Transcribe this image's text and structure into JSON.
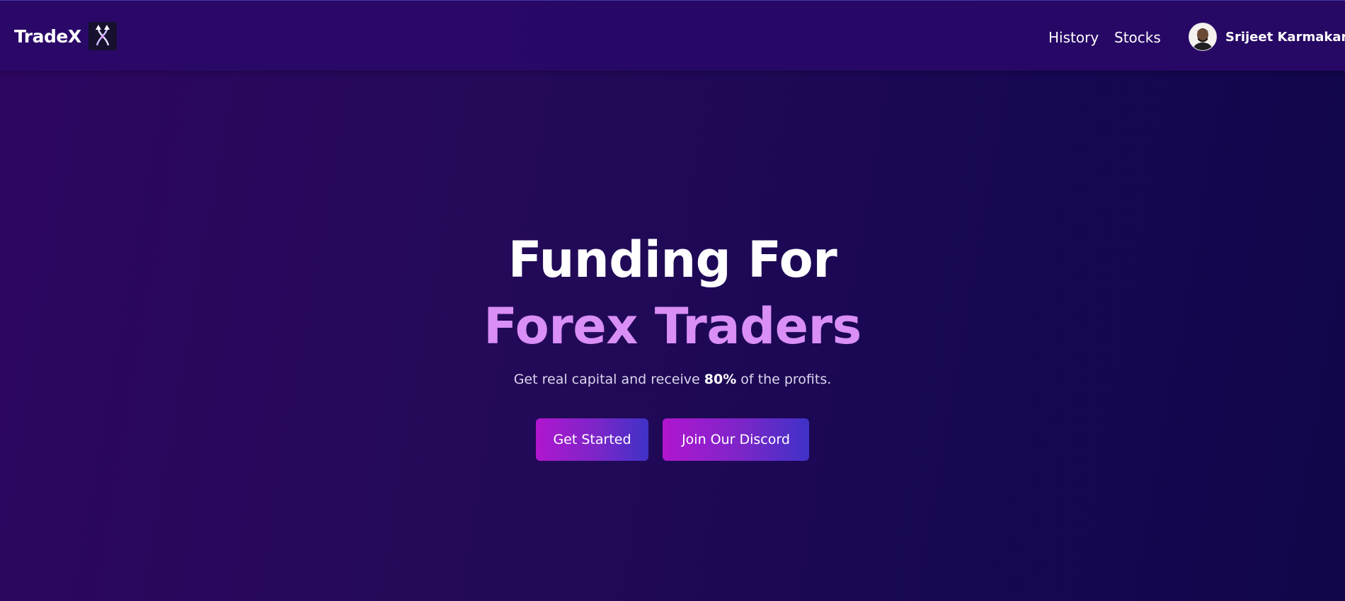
{
  "brand": {
    "name": "TradeX",
    "logo_icon": "crossed-arrows-icon"
  },
  "nav": {
    "links": [
      {
        "label": "History"
      },
      {
        "label": "Stocks"
      }
    ],
    "profile": {
      "name": "Srijeet Karmakar",
      "avatar_icon": "user-avatar-icon"
    }
  },
  "hero": {
    "title_line1": "Funding For",
    "title_line2": "Forex Traders",
    "subtitle_before": "Get real capital and receive ",
    "subtitle_bold": "80%",
    "subtitle_after": " of the profits.",
    "buttons": [
      {
        "label": "Get Started"
      },
      {
        "label": "Join Our Discord"
      }
    ]
  },
  "colors": {
    "background": "#230a58",
    "navbar": "#2a0868",
    "accent_text": "#d98ff5",
    "button_gradient_start": "#b016cf",
    "button_gradient_end": "#3f32c7"
  }
}
